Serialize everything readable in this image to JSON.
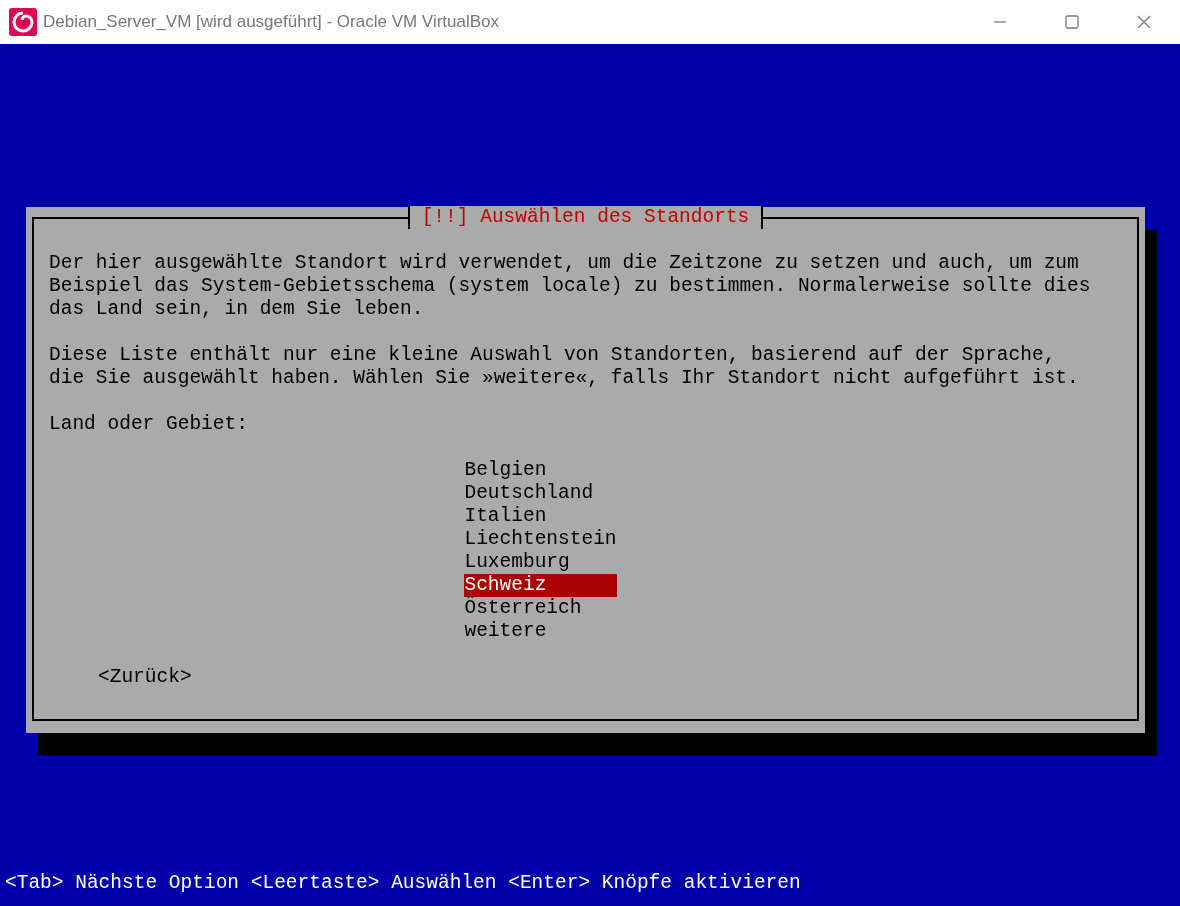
{
  "window": {
    "title": "Debian_Server_VM [wird ausgeführt] - Oracle VM VirtualBox"
  },
  "dialog": {
    "title": "[!!] Auswählen des Standorts",
    "paragraphs": [
      "Der hier ausgewählte Standort wird verwendet, um die Zeitzone zu setzen und auch, um zum Beispiel das System-Gebietsschema (system locale) zu bestimmen. Normalerweise sollte dies das Land sein, in dem Sie leben.",
      "Diese Liste enthält nur eine kleine Auswahl von Standorten, basierend auf der Sprache, die Sie ausgewählt haben. Wählen Sie »weitere«, falls Ihr Standort nicht aufgeführt ist."
    ],
    "prompt": "Land oder Gebiet:",
    "options": [
      {
        "label": "Belgien",
        "selected": false
      },
      {
        "label": "Deutschland",
        "selected": false
      },
      {
        "label": "Italien",
        "selected": false
      },
      {
        "label": "Liechtenstein",
        "selected": false
      },
      {
        "label": "Luxemburg",
        "selected": false
      },
      {
        "label": "Schweiz",
        "selected": true
      },
      {
        "label": "Österreich",
        "selected": false
      },
      {
        "label": "weitere",
        "selected": false
      }
    ],
    "back_button": "<Zurück>"
  },
  "status_bar": "<Tab> Nächste Option <Leertaste> Auswählen <Enter> Knöpfe aktivieren"
}
